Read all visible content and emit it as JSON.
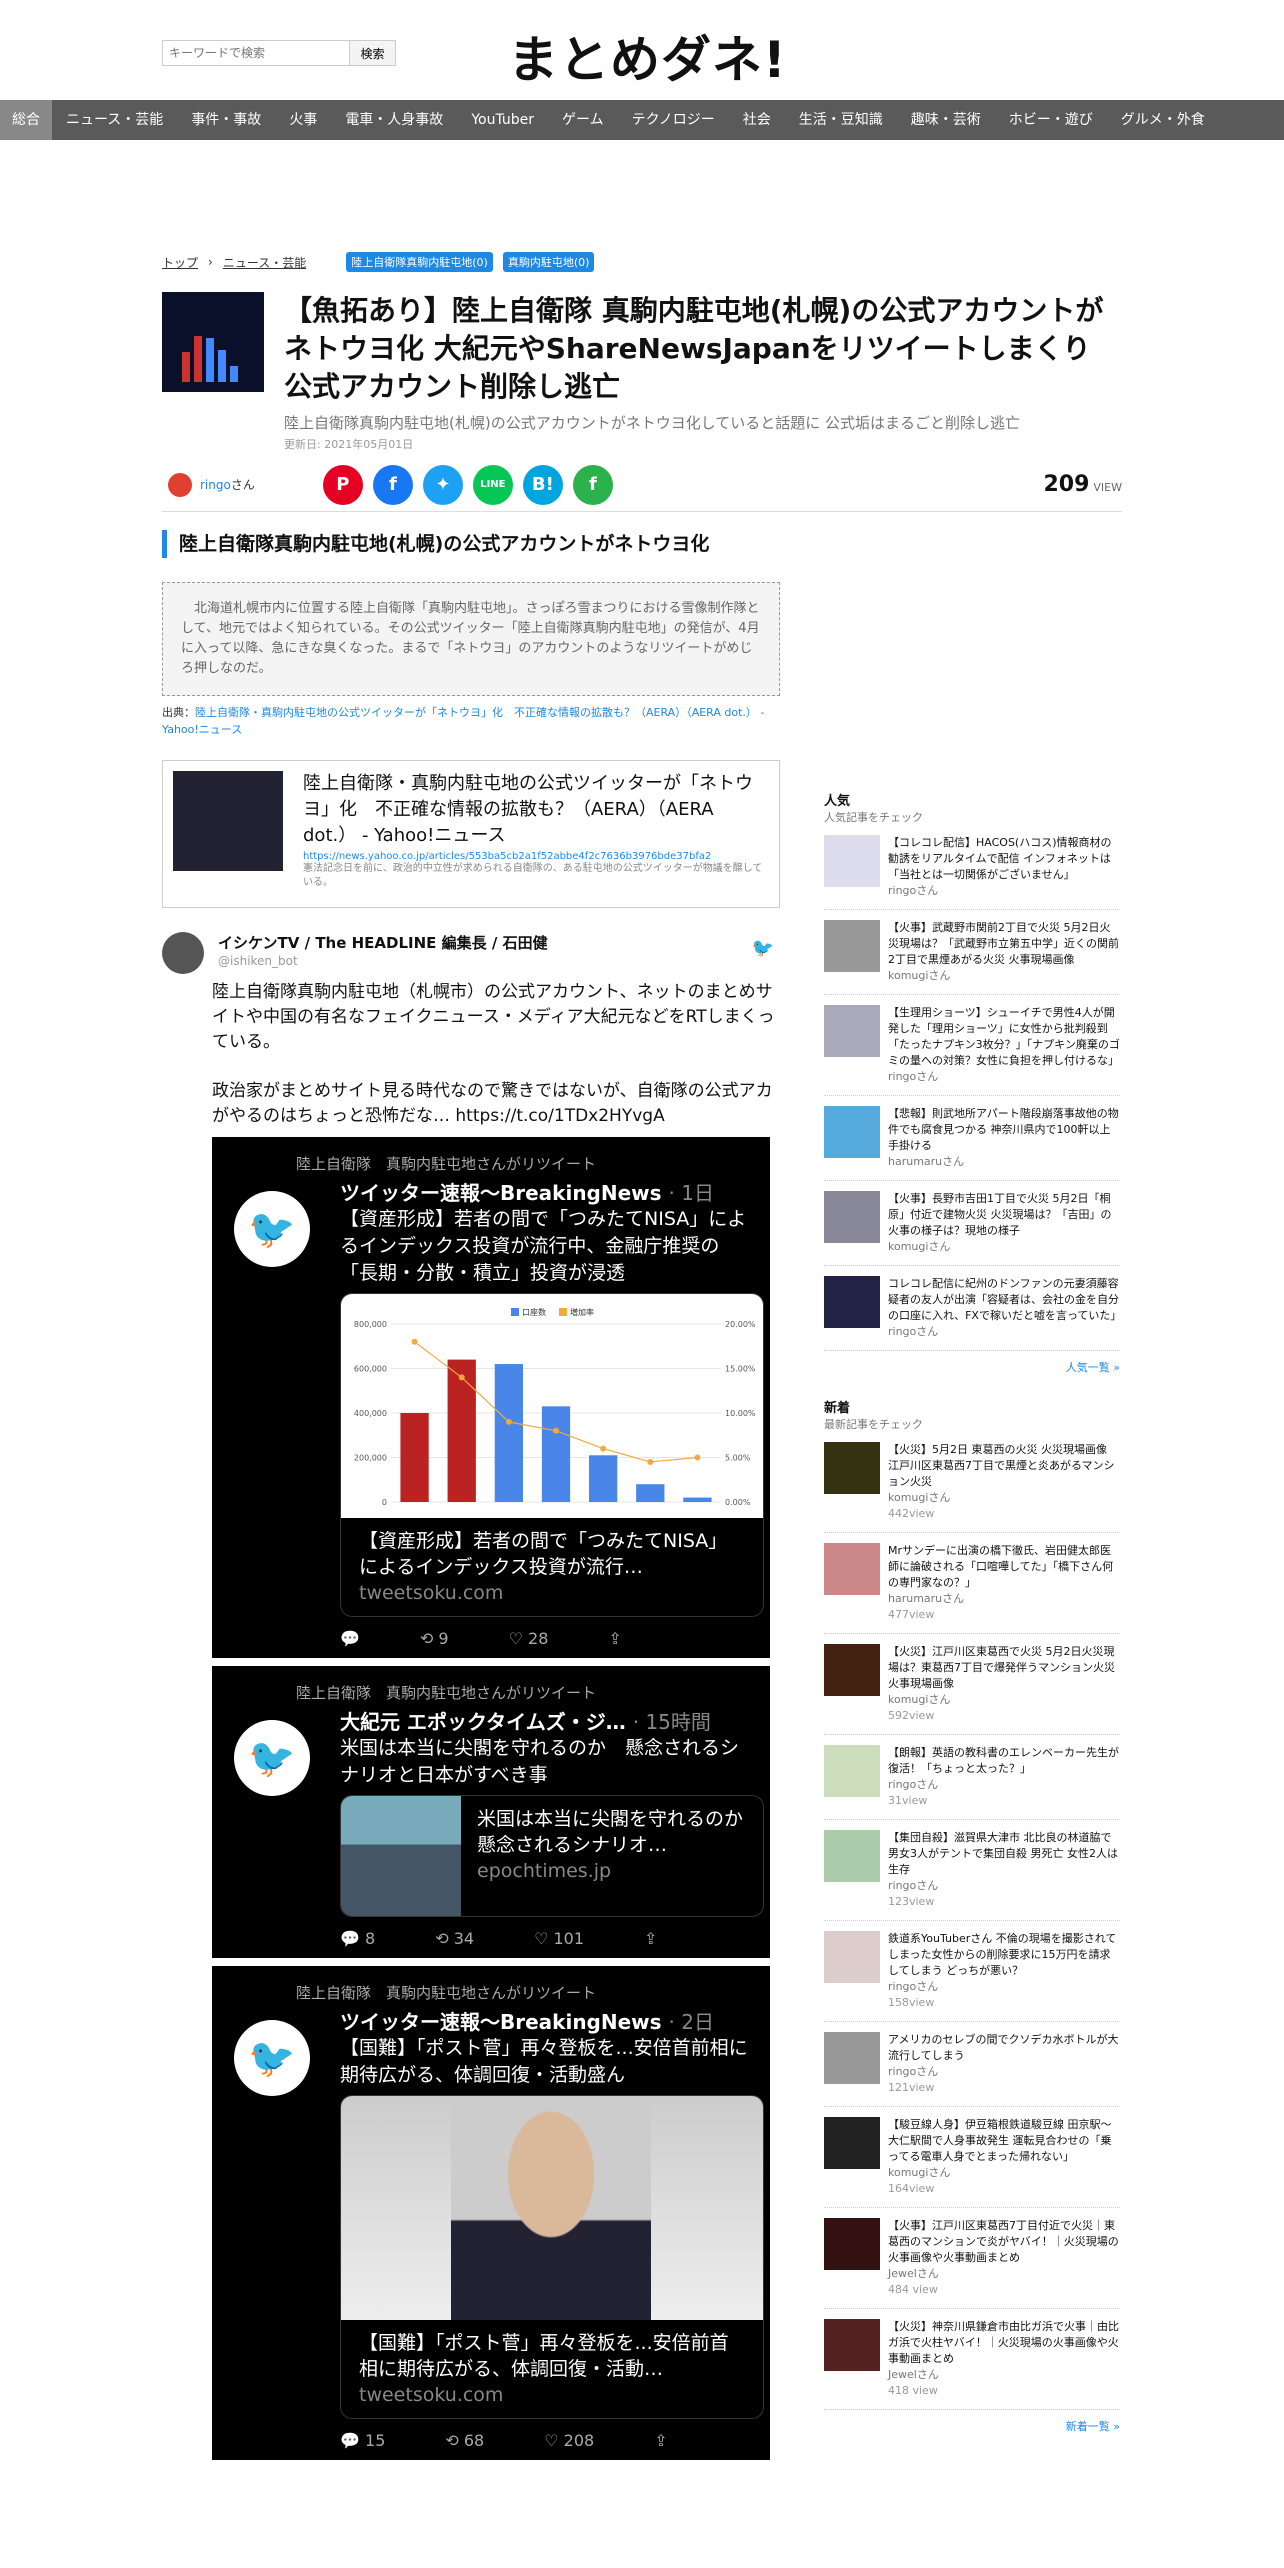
{
  "search": {
    "placeholder": "キーワードで検索",
    "button": "検索"
  },
  "logo": "まとめダネ!",
  "nav": [
    "総合",
    "ニュース・芸能",
    "事件・事故",
    "火事",
    "電車・人身事故",
    "YouTuber",
    "ゲーム",
    "テクノロジー",
    "社会",
    "生活・豆知識",
    "趣味・芸術",
    "ホビー・遊び",
    "グルメ・外食"
  ],
  "crumbs": {
    "home": "トップ",
    "cat": "ニュース・芸能",
    "tags": [
      "陸上自衛隊真駒内駐屯地(0)",
      "真駒内駐屯地(0)"
    ]
  },
  "article": {
    "title": "【魚拓あり】陸上自衛隊 真駒内駐屯地(札幌)の公式アカウントがネトウヨ化 大紀元やShareNewsJapanをリツイートしまくり 公式アカウント削除し逃亡",
    "subtitle": "陸上自衛隊真駒内駐屯地(札幌)の公式アカウントがネトウヨ化していると話題に 公式垢はまるごと削除し逃亡",
    "date": "更新日: 2021年05月01日",
    "author": "ringo",
    "author_suffix": "さん",
    "views": "209",
    "views_label": "VIEW"
  },
  "h2": "陸上自衛隊真駒内駐屯地(札幌)の公式アカウントがネトウヨ化",
  "quote": "北海道札幌市内に位置する陸上自衛隊「真駒内駐屯地」。さっぽろ雪まつりにおける雪像制作隊として、地元ではよく知られている。その公式ツイッター「陸上自衛隊真駒内駐屯地」の発信が、4月に入って以降、急にきな臭くなった。まるで「ネトウヨ」のアカウントのようなリツイートがめじろ押しなのだ。",
  "source": {
    "label": "出典：",
    "link": "陸上自衛隊・真駒内駐屯地の公式ツイッターが「ネトウヨ」化　不正確な情報の拡散も？（AERA）（AERA dot.） - Yahoo!ニュース"
  },
  "card": {
    "title": "陸上自衛隊・真駒内駐屯地の公式ツイッターが「ネトウヨ」化　不正確な情報の拡散も？（AERA）（AERA dot.） - Yahoo!ニュース",
    "url": "https://news.yahoo.co.jp/articles/553ba5cb2a1f52abbe4f2c7636b3976bde37bfa2",
    "desc": "憲法記念日を前に、政治的中立性が求められる自衛隊の、ある駐屯地の公式ツイッターが物議を醸している。"
  },
  "tweet": {
    "name": "イシケンTV / The HEADLINE 編集長 / 石田健",
    "handle": "@ishiken_bot",
    "text1": "陸上自衛隊真駒内駐屯地（札幌市）の公式アカウント、ネットのまとめサイトや中国の有名なフェイクニュース・メディア大紀元などをRTしまくっている。",
    "text2": "政治家がまとめサイト見る時代なので驚きではないが、自衛隊の公式アカがやるのはちょっと恐怖だな… https://t.co/1TDx2HYvgA"
  },
  "retweets": [
    {
      "rt": "陸上自衛隊　真駒内駐屯地さんがリツイート",
      "name": "ツイッター速報〜BreakingNews",
      "time": "· 1日",
      "text": "【資産形成】若者の間で「つみたてNISA」によるインデックス投資が流行中、金融庁推奨の「長期・分散・積立」投資が浸透",
      "cap": "【資産形成】若者の間で「つみたてNISA」によるインデックス投資が流行…",
      "dom": "tweetsoku.com",
      "reply": "",
      "rts": "9",
      "likes": "28"
    },
    {
      "rt": "陸上自衛隊　真駒内駐屯地さんがリツイート",
      "name": "大紀元 エポックタイムズ・ジ…",
      "time": "· 15時間",
      "text": "米国は本当に尖閣を守れるのか　懸念されるシナリオと日本がすべき事",
      "cap": "米国は本当に尖閣を守れるのか　懸念されるシナリオ…",
      "dom": "epochtimes.jp",
      "reply": "8",
      "rts": "34",
      "likes": "101"
    },
    {
      "rt": "陸上自衛隊　真駒内駐屯地さんがリツイート",
      "name": "ツイッター速報〜BreakingNews",
      "time": "· 2日",
      "text": "【国難】「ポスト菅」再々登板を...安倍首前相に期待広がる、体調回復・活動盛ん",
      "cap": "【国難】「ポスト菅」再々登板を...安倍前首相に期待広がる、体調回復・活動…",
      "dom": "tweetsoku.com",
      "reply": "15",
      "rts": "68",
      "likes": "208"
    }
  ],
  "chart_data": {
    "type": "bar",
    "legend": [
      "口座数",
      "増加率"
    ],
    "series": [
      {
        "name": "口座数",
        "values": [
          400000,
          640000,
          620000,
          430000,
          210000,
          80000,
          20000
        ]
      },
      {
        "name": "増加率",
        "values": [
          18,
          14,
          9,
          8,
          6,
          4.5,
          5
        ]
      }
    ],
    "ylim": [
      0,
      800000
    ],
    "yticks": [
      "800,000",
      "600,000",
      "400,000",
      "200,000",
      "0"
    ],
    "y2ticks": [
      "20.00%",
      "15.00%",
      "10.00%",
      "5.00%",
      "0.00%"
    ]
  },
  "popular": {
    "title": "人気",
    "sub": "人気記事をチェック",
    "more": "人気一覧 »",
    "items": [
      {
        "t": "【コレコレ配信】HACOS(ハコス)情報商材の勧誘をリアルタイムで配信 インフォネットは「当社とは一切関係がございません」",
        "u": "ringoさん",
        "c": "#dde"
      },
      {
        "t": "【火事】武蔵野市関前2丁目で火災 5月2日火災現場は？「武蔵野市立第五中学」近くの関前2丁目で黒煙あがる火災 火事現場画像",
        "u": "komugiさん",
        "c": "#999"
      },
      {
        "t": "【生理用ショーツ】シューイチで男性4人が開発した「理用ショーツ」に女性から批判殺到「たったナプキン3枚分？」「ナプキン廃棄のゴミの量への対策？女性に負担を押し付けるな」",
        "u": "ringoさん",
        "c": "#aab"
      },
      {
        "t": "【悲報】則武地所アパート階段崩落事故他の物件でも腐食見つかる 神奈川県内で100軒以上手掛ける",
        "u": "harumaruさん",
        "c": "#5ad"
      },
      {
        "t": "【火事】長野市吉田1丁目で火災 5月2日「桐原」付近で建物火災 火災現場は？「吉田」の火事の様子は？現地の様子",
        "u": "komugiさん",
        "c": "#889"
      },
      {
        "t": "コレコレ配信に紀州のドンファンの元妻須藤容疑者の友人が出演「容疑者は、会社の金を自分の口座に入れ、FXで稼いだと嘘を言っていた」",
        "u": "ringoさん",
        "c": "#224"
      }
    ]
  },
  "newest": {
    "title": "新着",
    "sub": "最新記事をチェック",
    "more": "新着一覧 »",
    "items": [
      {
        "t": "【火災】5月2日 東葛西の火災 火災現場画像 江戸川区東葛西7丁目で黒煙と炎あがるマンション火災",
        "u": "komugiさん",
        "v": "442view",
        "c": "#331"
      },
      {
        "t": "Mrサンデーに出演の橋下徹氏、岩田健太郎医師に論破される「口喧嘩してた」「橋下さん何の専門家なの？」",
        "u": "harumaruさん",
        "v": "477view",
        "c": "#c88"
      },
      {
        "t": "【火災】江戸川区東葛西で火災 5月2日火災現場は？東葛西7丁目で爆発伴うマンション火災 火事現場画像",
        "u": "komugiさん",
        "v": "592view",
        "c": "#421"
      },
      {
        "t": "【朗報】英語の教科書のエレンベーカー先生が復活！「ちょっと太った？」",
        "u": "ringoさん",
        "v": "31view",
        "c": "#cdb"
      },
      {
        "t": "【集団自殺】滋賀県大津市 北比良の林道脇で男女3人がテントで集団自殺 男死亡 女性2人は生存",
        "u": "ringoさん",
        "v": "123view",
        "c": "#aca"
      },
      {
        "t": "鉄道系YouTuberさん 不倫の現場を撮影されてしまった女性からの削除要求に15万円を請求してしまう どっちが悪い？",
        "u": "ringoさん",
        "v": "158view",
        "c": "#dcc"
      },
      {
        "t": "アメリカのセレブの間でクソデカ水ボトルが大流行してしまう",
        "u": "ringoさん",
        "v": "121view",
        "c": "#999"
      },
      {
        "t": "【駿豆線人身】伊豆箱根鉄道駿豆線 田京駅～大仁駅間で人身事故発生 運転見合わせの「乗ってる電車人身でとまった帰れない」",
        "u": "komugiさん",
        "v": "164view",
        "c": "#222"
      },
      {
        "t": "【火事】江戸川区東葛西7丁目付近で火災｜東葛西のマンションで炎がヤバイ！｜火災現場の火事画像や火事動画まとめ",
        "u": "Jewelさん",
        "v": "484 view",
        "c": "#311"
      },
      {
        "t": "【火災】神奈川県鎌倉市由比ガ浜で火事｜由比ガ浜で火柱ヤバイ！｜火災現場の火事画像や火事動画まとめ",
        "u": "Jewelさん",
        "v": "418 view",
        "c": "#522"
      }
    ]
  },
  "colors": {
    "accent": "#1e88e5",
    "nav": "#5a5a5a",
    "pinterest": "#e60023",
    "facebook": "#1877f2",
    "twitter": "#1da1f2",
    "line": "#06c755",
    "hatena": "#00a4de",
    "feedly": "#2bb24c"
  }
}
